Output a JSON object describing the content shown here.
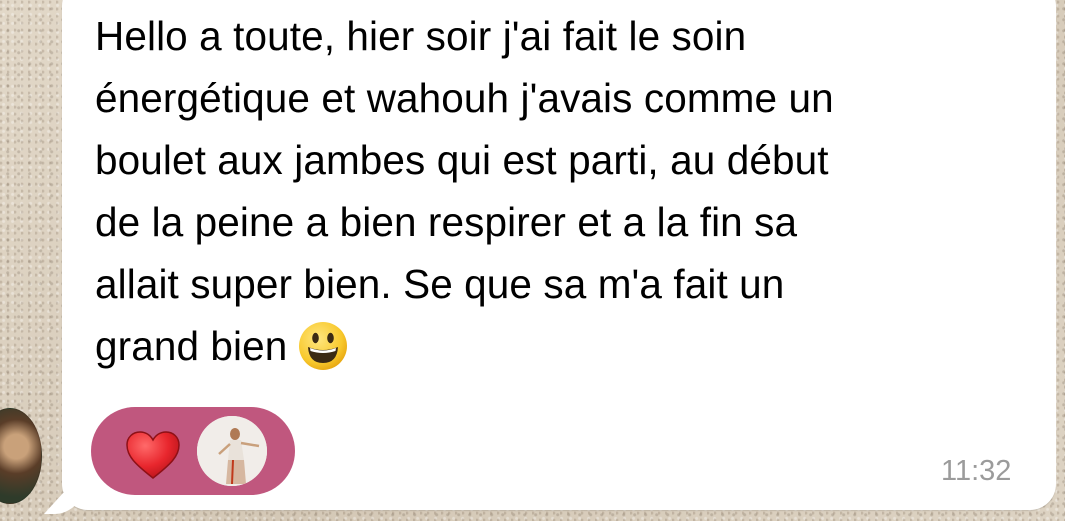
{
  "message": {
    "lines": [
      "Hello a toute, hier soir j'ai fait le soin",
      "énergétique et wahouh j'avais comme un",
      "boulet aux jambes qui est parti, au début",
      "de la peine a bien respirer et a la fin sa",
      "allait super bien. Se que sa m'a fait un",
      "grand bien"
    ],
    "emoji": "grinning-face-emoji",
    "time": "11:32"
  },
  "reactions": {
    "emoji": "red-heart-icon",
    "background_color": "#c0577e"
  },
  "colors": {
    "bubble": "#ffffff",
    "timestamp": "#9b9b9b"
  }
}
